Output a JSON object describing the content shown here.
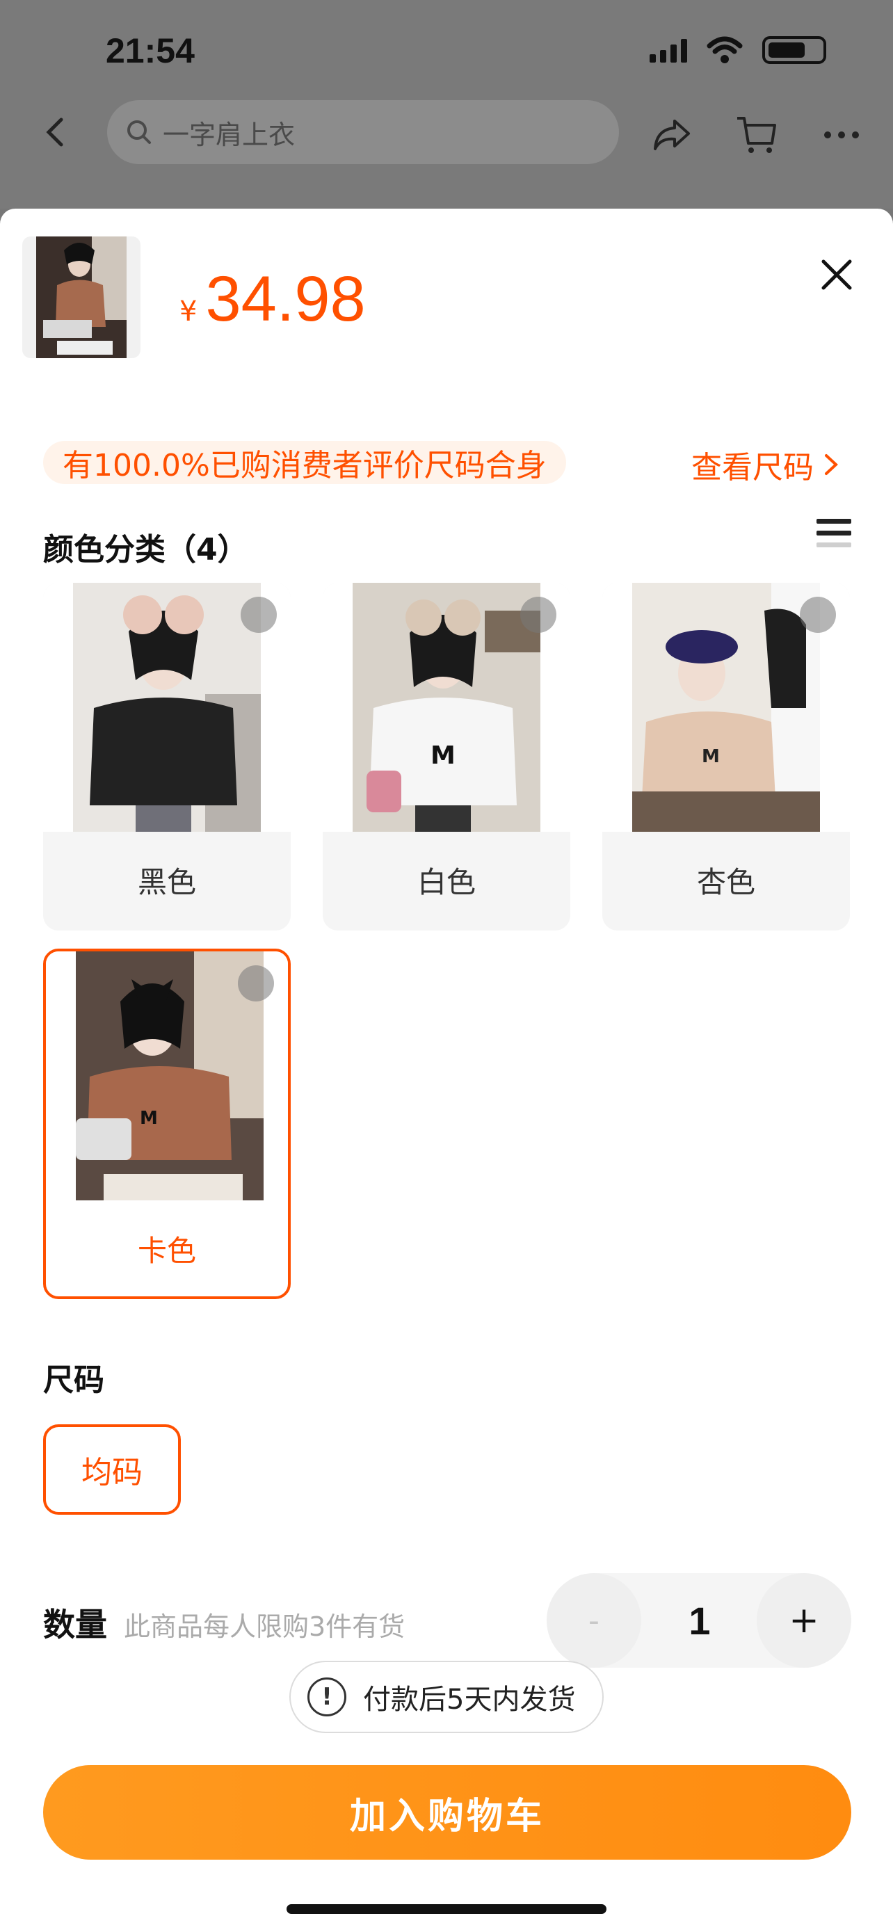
{
  "status_bar": {
    "time": "21:54"
  },
  "nav": {
    "search_placeholder": "一字肩上衣"
  },
  "product": {
    "currency": "¥",
    "price": "34.98"
  },
  "fit_notice": "有100.0%已购消费者评价尺码合身",
  "size_chart_link": "查看尺码",
  "color_section": {
    "title": "颜色分类（4）",
    "options": [
      {
        "label": "黑色",
        "selected": false
      },
      {
        "label": "白色",
        "selected": false
      },
      {
        "label": "杏色",
        "selected": false
      },
      {
        "label": "卡色",
        "selected": true
      }
    ]
  },
  "size_section": {
    "title": "尺码",
    "options": [
      {
        "label": "均码",
        "selected": true
      }
    ]
  },
  "quantity": {
    "label": "数量",
    "hint": "此商品每人限购3件有货",
    "value": "1",
    "minus": "-",
    "plus": "+"
  },
  "shipping_notice": "付款后5天内发货",
  "add_to_cart": "加入购物车",
  "colors": {
    "accent": "#ff5000",
    "cart_button": "#ff9a1f"
  }
}
